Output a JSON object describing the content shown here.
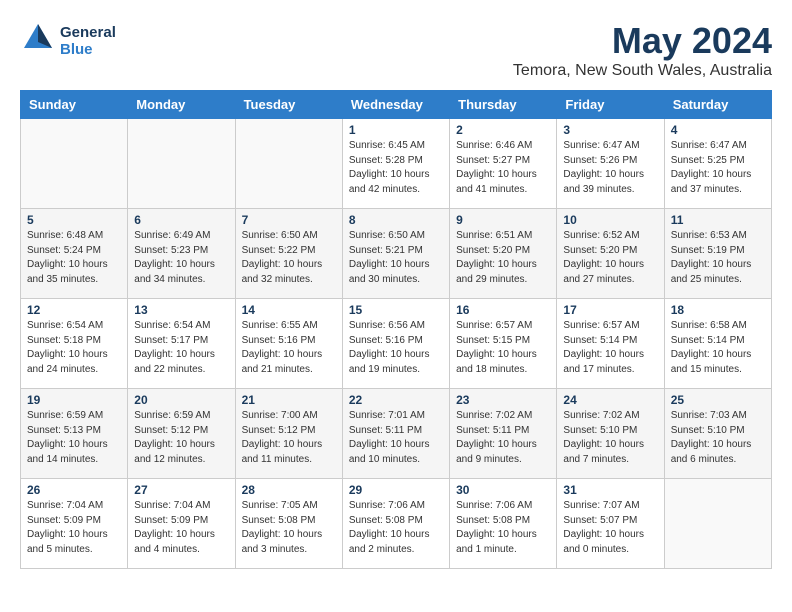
{
  "logo": {
    "line1": "General",
    "line2": "Blue"
  },
  "title": "May 2024",
  "location": "Temora, New South Wales, Australia",
  "days_header": [
    "Sunday",
    "Monday",
    "Tuesday",
    "Wednesday",
    "Thursday",
    "Friday",
    "Saturday"
  ],
  "weeks": [
    [
      {
        "num": "",
        "info": ""
      },
      {
        "num": "",
        "info": ""
      },
      {
        "num": "",
        "info": ""
      },
      {
        "num": "1",
        "info": "Sunrise: 6:45 AM\nSunset: 5:28 PM\nDaylight: 10 hours\nand 42 minutes."
      },
      {
        "num": "2",
        "info": "Sunrise: 6:46 AM\nSunset: 5:27 PM\nDaylight: 10 hours\nand 41 minutes."
      },
      {
        "num": "3",
        "info": "Sunrise: 6:47 AM\nSunset: 5:26 PM\nDaylight: 10 hours\nand 39 minutes."
      },
      {
        "num": "4",
        "info": "Sunrise: 6:47 AM\nSunset: 5:25 PM\nDaylight: 10 hours\nand 37 minutes."
      }
    ],
    [
      {
        "num": "5",
        "info": "Sunrise: 6:48 AM\nSunset: 5:24 PM\nDaylight: 10 hours\nand 35 minutes."
      },
      {
        "num": "6",
        "info": "Sunrise: 6:49 AM\nSunset: 5:23 PM\nDaylight: 10 hours\nand 34 minutes."
      },
      {
        "num": "7",
        "info": "Sunrise: 6:50 AM\nSunset: 5:22 PM\nDaylight: 10 hours\nand 32 minutes."
      },
      {
        "num": "8",
        "info": "Sunrise: 6:50 AM\nSunset: 5:21 PM\nDaylight: 10 hours\nand 30 minutes."
      },
      {
        "num": "9",
        "info": "Sunrise: 6:51 AM\nSunset: 5:20 PM\nDaylight: 10 hours\nand 29 minutes."
      },
      {
        "num": "10",
        "info": "Sunrise: 6:52 AM\nSunset: 5:20 PM\nDaylight: 10 hours\nand 27 minutes."
      },
      {
        "num": "11",
        "info": "Sunrise: 6:53 AM\nSunset: 5:19 PM\nDaylight: 10 hours\nand 25 minutes."
      }
    ],
    [
      {
        "num": "12",
        "info": "Sunrise: 6:54 AM\nSunset: 5:18 PM\nDaylight: 10 hours\nand 24 minutes."
      },
      {
        "num": "13",
        "info": "Sunrise: 6:54 AM\nSunset: 5:17 PM\nDaylight: 10 hours\nand 22 minutes."
      },
      {
        "num": "14",
        "info": "Sunrise: 6:55 AM\nSunset: 5:16 PM\nDaylight: 10 hours\nand 21 minutes."
      },
      {
        "num": "15",
        "info": "Sunrise: 6:56 AM\nSunset: 5:16 PM\nDaylight: 10 hours\nand 19 minutes."
      },
      {
        "num": "16",
        "info": "Sunrise: 6:57 AM\nSunset: 5:15 PM\nDaylight: 10 hours\nand 18 minutes."
      },
      {
        "num": "17",
        "info": "Sunrise: 6:57 AM\nSunset: 5:14 PM\nDaylight: 10 hours\nand 17 minutes."
      },
      {
        "num": "18",
        "info": "Sunrise: 6:58 AM\nSunset: 5:14 PM\nDaylight: 10 hours\nand 15 minutes."
      }
    ],
    [
      {
        "num": "19",
        "info": "Sunrise: 6:59 AM\nSunset: 5:13 PM\nDaylight: 10 hours\nand 14 minutes."
      },
      {
        "num": "20",
        "info": "Sunrise: 6:59 AM\nSunset: 5:12 PM\nDaylight: 10 hours\nand 12 minutes."
      },
      {
        "num": "21",
        "info": "Sunrise: 7:00 AM\nSunset: 5:12 PM\nDaylight: 10 hours\nand 11 minutes."
      },
      {
        "num": "22",
        "info": "Sunrise: 7:01 AM\nSunset: 5:11 PM\nDaylight: 10 hours\nand 10 minutes."
      },
      {
        "num": "23",
        "info": "Sunrise: 7:02 AM\nSunset: 5:11 PM\nDaylight: 10 hours\nand 9 minutes."
      },
      {
        "num": "24",
        "info": "Sunrise: 7:02 AM\nSunset: 5:10 PM\nDaylight: 10 hours\nand 7 minutes."
      },
      {
        "num": "25",
        "info": "Sunrise: 7:03 AM\nSunset: 5:10 PM\nDaylight: 10 hours\nand 6 minutes."
      }
    ],
    [
      {
        "num": "26",
        "info": "Sunrise: 7:04 AM\nSunset: 5:09 PM\nDaylight: 10 hours\nand 5 minutes."
      },
      {
        "num": "27",
        "info": "Sunrise: 7:04 AM\nSunset: 5:09 PM\nDaylight: 10 hours\nand 4 minutes."
      },
      {
        "num": "28",
        "info": "Sunrise: 7:05 AM\nSunset: 5:08 PM\nDaylight: 10 hours\nand 3 minutes."
      },
      {
        "num": "29",
        "info": "Sunrise: 7:06 AM\nSunset: 5:08 PM\nDaylight: 10 hours\nand 2 minutes."
      },
      {
        "num": "30",
        "info": "Sunrise: 7:06 AM\nSunset: 5:08 PM\nDaylight: 10 hours\nand 1 minute."
      },
      {
        "num": "31",
        "info": "Sunrise: 7:07 AM\nSunset: 5:07 PM\nDaylight: 10 hours\nand 0 minutes."
      },
      {
        "num": "",
        "info": ""
      }
    ]
  ]
}
